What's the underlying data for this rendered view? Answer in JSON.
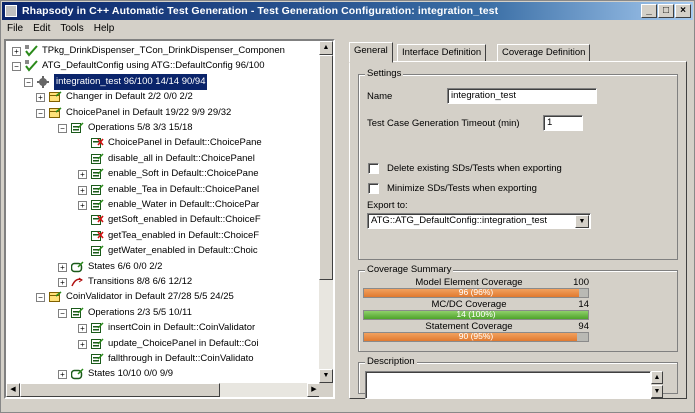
{
  "window": {
    "title": "Rhapsody in C++ Automatic Test Generation - Test Generation Configuration: integration_test",
    "minimize": "_",
    "maximize": "□",
    "close": "×"
  },
  "menu": [
    "File",
    "Edit",
    "Tools",
    "Help"
  ],
  "tree": [
    {
      "label": "TPkg_DrinkDispenser_TCon_DrinkDispenser_Componen",
      "exp": "+",
      "icon": "tool-check-icon",
      "indent": 0
    },
    {
      "label": "ATG_DefaultConfig using ATG::DefaultConfig  96/100",
      "exp": "−",
      "icon": "tool-check-icon",
      "indent": 0
    },
    {
      "label": "integration_test  96/100  14/14  90/94",
      "exp": "−",
      "icon": "gear-icon",
      "indent": 1,
      "selected": true
    },
    {
      "label": "Changer in Default  2/2  0/0  2/2",
      "exp": "+",
      "icon": "class-icon",
      "indent": 2
    },
    {
      "label": "ChoicePanel in Default  19/22  9/9  29/32",
      "exp": "−",
      "icon": "class-icon",
      "indent": 2
    },
    {
      "label": "Operations  5/8  3/3  15/18",
      "exp": "−",
      "icon": "operation-icon",
      "indent": 3
    },
    {
      "label": "ChoicePanel in Default::ChoicePane",
      "exp": "",
      "icon": "operation-red-icon",
      "indent": 4
    },
    {
      "label": "disable_all in Default::ChoicePanel",
      "exp": "",
      "icon": "operation-icon",
      "indent": 4
    },
    {
      "label": "enable_Soft in Default::ChoicePane",
      "exp": "+",
      "icon": "operation-icon",
      "indent": 4
    },
    {
      "label": "enable_Tea in Default::ChoicePanel",
      "exp": "+",
      "icon": "operation-icon",
      "indent": 4
    },
    {
      "label": "enable_Water in Default::ChoicePar",
      "exp": "+",
      "icon": "operation-icon",
      "indent": 4
    },
    {
      "label": "getSoft_enabled in Default::ChoiceF",
      "exp": "",
      "icon": "operation-red-icon",
      "indent": 4
    },
    {
      "label": "getTea_enabled in Default::ChoiceF",
      "exp": "",
      "icon": "operation-red-icon",
      "indent": 4
    },
    {
      "label": "getWater_enabled in Default::Choic",
      "exp": "",
      "icon": "operation-icon",
      "indent": 4
    },
    {
      "label": "States  6/6  0/0  2/2",
      "exp": "+",
      "icon": "states-icon",
      "indent": 3
    },
    {
      "label": "Transitions  8/8  6/6  12/12",
      "exp": "+",
      "icon": "transition-icon",
      "indent": 3
    },
    {
      "label": "CoinValidator in Default  27/28  5/5  24/25",
      "exp": "−",
      "icon": "class-icon",
      "indent": 2
    },
    {
      "label": "Operations  2/3  5/5  10/11",
      "exp": "−",
      "icon": "operation-icon",
      "indent": 3
    },
    {
      "label": "insertCoin in Default::CoinValidator",
      "exp": "+",
      "icon": "operation-icon",
      "indent": 4
    },
    {
      "label": "update_ChoicePanel in Default::Coi",
      "exp": "+",
      "icon": "operation-icon",
      "indent": 4
    },
    {
      "label": "fallthrough in Default::CoinValidato",
      "exp": "",
      "icon": "operation-icon",
      "indent": 4
    },
    {
      "label": "States  10/10  0/0  9/9",
      "exp": "+",
      "icon": "states-icon",
      "indent": 3
    }
  ],
  "tabs": [
    "General",
    "Interface Definition",
    "Coverage Definition"
  ],
  "settings": {
    "legend": "Settings",
    "name_label": "Name",
    "name_value": "integration_test",
    "timeout_label": "Test Case Generation Timeout (min)",
    "timeout_value": "1",
    "delete_label": "Delete existing SDs/Tests when exporting",
    "minimize_label": "Minimize SDs/Tests when exporting",
    "export_label": "Export to:",
    "export_value": "ATG::ATG_DefaultConfig::integration_test"
  },
  "coverage": {
    "legend": "Coverage Summary",
    "rows": [
      {
        "label": "Model Element Coverage",
        "value": "100",
        "bar_text": "96 (96%)",
        "fraction": 0.96,
        "color": "#e07a30"
      },
      {
        "label": "MC/DC Coverage",
        "value": "14",
        "bar_text": "14 (100%)",
        "fraction": 1.0,
        "color": "#4ea32a"
      },
      {
        "label": "Statement Coverage",
        "value": "94",
        "bar_text": "90 (95%)",
        "fraction": 0.95,
        "color": "#e07a30"
      }
    ]
  },
  "description": {
    "legend": "Description"
  }
}
